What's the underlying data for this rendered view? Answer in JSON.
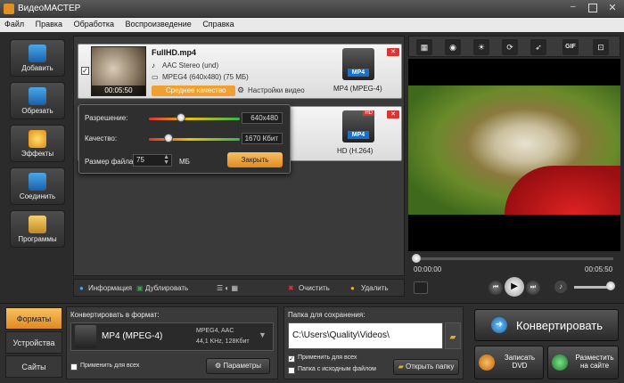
{
  "app": {
    "title": "ВидеоМАСТЕР"
  },
  "menu": [
    "Файл",
    "Правка",
    "Обработка",
    "Воспроизведение",
    "Справка"
  ],
  "sidebar": {
    "items": [
      {
        "label": "Добавить",
        "icon": "film-add-icon",
        "color": "#3aa34a"
      },
      {
        "label": "Обрезать",
        "icon": "film-cut-icon",
        "color": "#2c7fd6"
      },
      {
        "label": "Эффекты",
        "icon": "effects-icon",
        "color": "#e0a020"
      },
      {
        "label": "Соединить",
        "icon": "join-icon",
        "color": "#3aa34a"
      },
      {
        "label": "Программы",
        "icon": "programs-icon",
        "color": "#e0b030"
      }
    ]
  },
  "files": [
    {
      "name": "FullHD.mp4",
      "audio": "AAC Stereo (und)",
      "video": "MPEG4 (640x480) (75 МБ)",
      "duration": "00:05:50",
      "quality": "Среднее качество",
      "settings": "Настройки видео",
      "format": "MP4 (MPEG-4)",
      "badge": "MP4",
      "checked": true
    },
    {
      "format": "HD (H.264)",
      "badge": "MP4",
      "hd": "HD"
    }
  ],
  "popup": {
    "resolution_label": "Разрешение:",
    "resolution_value": "640x480",
    "resolution_level": 0.35,
    "quality_label": "Качество:",
    "quality_value": "1670 Кбит",
    "quality_level": 0.22,
    "size_label": "Размер файла:",
    "size_value": "75",
    "size_unit": "МБ",
    "close_label": "Закрыть"
  },
  "listbar": {
    "info": "Информация",
    "duplicate": "Дублировать",
    "clear": "Очистить",
    "delete": "Удалить"
  },
  "video_toolbar": [
    "crop-icon",
    "film-icon",
    "brightness-icon",
    "rotate-icon",
    "speed-icon",
    "GIF",
    "extract-icon"
  ],
  "player": {
    "current_time": "00:00:00",
    "total_time": "00:05:50",
    "progress": 0.0
  },
  "bottom": {
    "tabs": [
      "Форматы",
      "Устройства",
      "Сайты"
    ],
    "convert_to_label": "Конвертировать в формат:",
    "format_name": "MP4 (MPEG-4)",
    "format_codecs": "MPEG4, AAC",
    "format_params": "44,1 KHz, 128Кбит",
    "apply_all": "Применить для всех",
    "params_btn": "Параметры",
    "folder_label": "Папка для сохранения:",
    "folder_path": "C:\\Users\\Quality\\Videos\\",
    "apply_all2": "Применить для всех",
    "source_folder": "Папка с исходным файлом",
    "open_folder": "Открыть папку",
    "convert": "Конвертировать",
    "burn_dvd": "Записать DVD",
    "publish": "Разместить на сайте"
  },
  "colors": {
    "accent_orange": "#f0a030",
    "tab_active": "#f4a838"
  }
}
